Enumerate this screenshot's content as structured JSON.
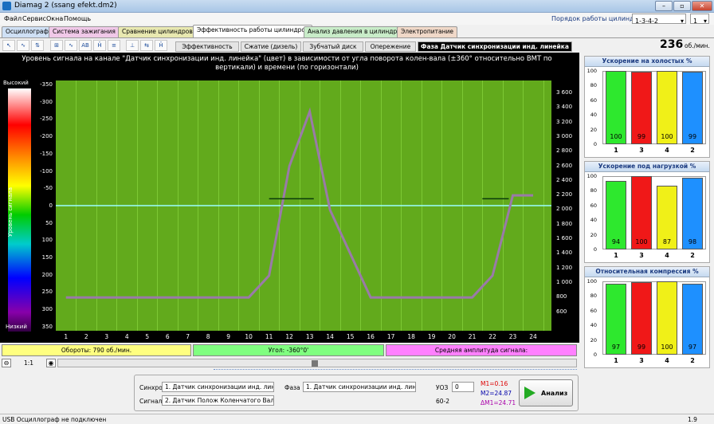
{
  "window": {
    "title": "Diamag 2 (ssang efekt.dm2)",
    "min": "–",
    "max": "▫",
    "close": "✕"
  },
  "menu": [
    "Файл",
    "Сервис",
    "Окна",
    "Помощь"
  ],
  "firing": {
    "label": "Порядок работы цилиндров",
    "order": "1-3-4-2",
    "cyl": "1"
  },
  "tabs": [
    "Осциллограф",
    "Система зажигания",
    "Сравнение цилиндров",
    "Эффективность работы цилиндров",
    "Анализ давления в цилиндре",
    "Электропитание"
  ],
  "tools": [
    "↖",
    "∿",
    "⇅",
    "AB",
    "⊞",
    "Ĥ",
    "≡",
    "⇆",
    "⊥"
  ],
  "subtabs": [
    "Эффективность",
    "Сжатие (дизель)",
    "Зубчатый диск",
    "Опережение",
    "Фаза Датчик синхронизации инд. линейка"
  ],
  "rpm": {
    "value": "236",
    "unit": "об./мин."
  },
  "chart_data": {
    "type": "heatmap",
    "title": "Уровень сигнала на канале \"Датчик синхронизации инд. линейка\" (цвет) в зависимости от угла поворота колен-вала (±360° относительно ВМТ по вертикали) и времени (по горизонтали)",
    "y_ticks": [
      "-350",
      "-300",
      "-250",
      "-200",
      "-150",
      "-100",
      "-50",
      "0",
      "50",
      "100",
      "150",
      "200",
      "250",
      "300",
      "350"
    ],
    "y_range": [
      -360,
      360
    ],
    "rpm_ticks": [
      "3 600",
      "3 400",
      "3 200",
      "3 000",
      "2 800",
      "2 600",
      "2 400",
      "2 200",
      "2 000",
      "1 800",
      "1 600",
      "1 400",
      "1 200",
      "1 000",
      "800",
      "600"
    ],
    "x_ticks": [
      "1",
      "2",
      "3",
      "4",
      "5",
      "6",
      "7",
      "8",
      "9",
      "10",
      "11",
      "12",
      "13",
      "14",
      "15",
      "16",
      "17",
      "18",
      "19",
      "20",
      "21",
      "22",
      "23",
      "24"
    ],
    "legend": {
      "high": "Высокий",
      "low": "Низкий",
      "axis": "Уровень сигнала"
    },
    "rpm_curve": {
      "x": [
        1,
        10,
        11,
        12,
        13,
        14,
        16,
        17,
        21,
        22,
        23,
        24
      ],
      "rpm": [
        800,
        800,
        1100,
        2600,
        3350,
        2000,
        800,
        800,
        800,
        1100,
        2200,
        2200
      ]
    }
  },
  "infobar": {
    "rpm": "Обороты:  790 об./мин.",
    "angle": "Угол:  -360°0'",
    "amp": "Средняя амплитуда сигнала:"
  },
  "nav": {
    "zoom": "1:1"
  },
  "panels": [
    {
      "title": "Ускорение на холостых %",
      "bars": [
        {
          "cyl": "1",
          "value": 100,
          "color": "#2ee82e"
        },
        {
          "cyl": "3",
          "value": 99,
          "color": "#f01818"
        },
        {
          "cyl": "4",
          "value": 100,
          "color": "#f0f018"
        },
        {
          "cyl": "2",
          "value": 99,
          "color": "#1e90ff"
        }
      ]
    },
    {
      "title": "Ускорение под нагрузкой %",
      "bars": [
        {
          "cyl": "1",
          "value": 94,
          "color": "#2ee82e"
        },
        {
          "cyl": "3",
          "value": 100,
          "color": "#f01818"
        },
        {
          "cyl": "4",
          "value": 87,
          "color": "#f0f018"
        },
        {
          "cyl": "2",
          "value": 98,
          "color": "#1e90ff"
        }
      ]
    },
    {
      "title": "Относительная компрессия %",
      "bars": [
        {
          "cyl": "1",
          "value": 97,
          "color": "#2ee82e"
        },
        {
          "cyl": "3",
          "value": 99,
          "color": "#f01818"
        },
        {
          "cyl": "4",
          "value": 100,
          "color": "#f0f018"
        },
        {
          "cyl": "2",
          "value": 97,
          "color": "#1e90ff"
        }
      ]
    }
  ],
  "panel_ticks": [
    "100",
    "80",
    "60",
    "40",
    "20",
    "0"
  ],
  "controls": {
    "sync_label": "Синхро:",
    "sync": "1.  Датчик синхронизации инд. лин",
    "signal_label": "Сигнал:",
    "signal": "2.  Датчик Полож Коленчатого Вал",
    "phase_label": "Фаза",
    "phase": "1.  Датчик синхронизации инд. лин",
    "uoz_label": "УОЗ",
    "uoz": "0",
    "teeth": "60-2",
    "m1": "M1=0.16",
    "m2": "M2=24.87",
    "dm": "ΔM1=24.71",
    "analyze": "Анализ"
  },
  "status": {
    "left": "USB Осциллограф не подключен",
    "right": "1.9"
  }
}
